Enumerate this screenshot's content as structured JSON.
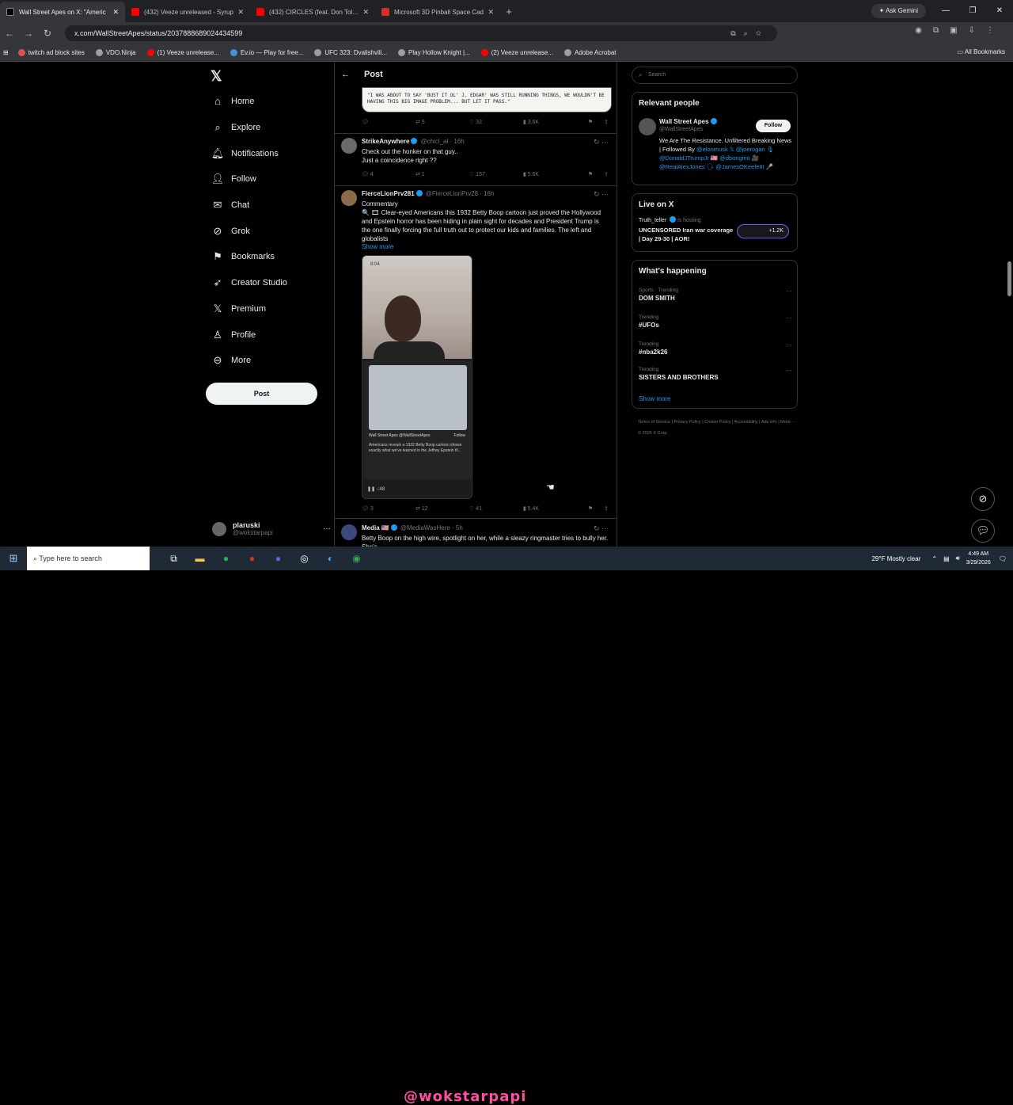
{
  "browser": {
    "tabs": [
      {
        "title": "Wall Street Apes on X: \"Americ",
        "color": "#e7e9ea",
        "active": true
      },
      {
        "title": "(432) Veeze unreleased - Syrup",
        "color": "#ff0000",
        "active": false
      },
      {
        "title": "(432) CIRCLES (feat. Don Toliver",
        "color": "#ff0000",
        "active": false
      },
      {
        "title": "Microsoft 3D Pinball Space Cad",
        "color": "#d93025",
        "active": false
      }
    ],
    "new_tab": "+",
    "ask_gemini": "Ask Gemini",
    "url": "x.com/WallStreetApes/status/2037888689024434599",
    "bookmarks": [
      {
        "label": "twitch ad block sites",
        "color": "#d9534f"
      },
      {
        "label": "VDO.Ninja",
        "color": "#9e9e9e"
      },
      {
        "label": "(1) Veeze unrelease...",
        "color": "#ff0000"
      },
      {
        "label": "Ev.io — Play for free...",
        "color": "#4a90d9"
      },
      {
        "label": "UFC 323: Dvalishvili...",
        "color": "#9e9e9e"
      },
      {
        "label": "Play Hollow Knight |...",
        "color": "#9e9e9e"
      },
      {
        "label": "(2) Veeze unrelease...",
        "color": "#ff0000"
      },
      {
        "label": "Adobe Acrobat",
        "color": "#9e9e9e"
      }
    ],
    "all_bookmarks": "All Bookmarks"
  },
  "nav": {
    "items": [
      {
        "label": "Home",
        "icon": "home-icon"
      },
      {
        "label": "Explore",
        "icon": "search-icon"
      },
      {
        "label": "Notifications",
        "icon": "bell-icon"
      },
      {
        "label": "Follow",
        "icon": "follow-icon"
      },
      {
        "label": "Chat",
        "icon": "mail-icon"
      },
      {
        "label": "Grok",
        "icon": "grok-icon"
      },
      {
        "label": "Bookmarks",
        "icon": "bookmark-icon"
      },
      {
        "label": "Creator Studio",
        "icon": "rocket-icon"
      },
      {
        "label": "Premium",
        "icon": "x-icon"
      },
      {
        "label": "Profile",
        "icon": "person-icon"
      },
      {
        "label": "More",
        "icon": "more-icon"
      }
    ],
    "post_button": "Post",
    "user": {
      "name": "plaruski",
      "handle": "@wokstarpapi"
    }
  },
  "timeline": {
    "header": "Post",
    "comic_text": "\"I WAS ABOUT TO SAY 'BUST IT OL' J. EDGAR' WAS STILL RUNNING THINGS, WE WOULDN'T BE HAVING THIS BIG IMAGE PROBLEM... BUT LET IT PASS.\"",
    "first_actions": {
      "replies": "",
      "reposts": "5",
      "likes": "32",
      "views": "3.6K"
    },
    "tweets": [
      {
        "author": "StrikeAnywhere",
        "handle": "@chicl_al · 16h",
        "text": "Check out the honker on that guy..\nJust a coincidence right ??",
        "replies": "4",
        "reposts": "1",
        "likes": "157",
        "views": "5.6K"
      },
      {
        "author": "FierceLionPrv281",
        "handle": "@FierceLionPrv28 · 16h",
        "label": "Commentary",
        "text": "🔍 🎞 Clear-eyed Americans this 1932 Betty Boop cartoon just proved the Hollywood and Epstein horror has been hiding in plain sight for decades and President Trump is the one finally forcing the full truth out to protect our kids and families. The left and globalists",
        "show_more": "Show more",
        "replies": "3",
        "reposts": "12",
        "likes": "41",
        "views": "5.4K"
      },
      {
        "author": "Media 🇺🇸",
        "handle": "@MediaWasHere · 5h",
        "text": "Betty Boop on the high wire, spotlight on her, while a sleazy ringmaster tries to bully her. She's"
      }
    ],
    "video": {
      "time": "8:04",
      "card_author": "Wall Street Apes",
      "card_handle": "@WallStreetApes",
      "card_follow": "Follow",
      "card_text": "Americans reveals a 1932 Betty Boop cartoon shows exactly what we've learned in the Jeffrey Epstein fil...",
      "counter": "-:48"
    }
  },
  "sidebar": {
    "search_placeholder": "Search",
    "relevant": {
      "title": "Relevant people",
      "name": "Wall Street Apes",
      "handle": "@WallStreetApes",
      "follow": "Follow",
      "bio": "We Are The Resistance. Unfiltered Breaking News | Followed By",
      "mentions": "@elonmusk 𝕏 @joerogan 🎙 @DonaldJTrumpJr 🇺🇸 @dbongino 🎥 @RealAlexJones 🗣 @JamesOKeefeIII 🎤"
    },
    "live": {
      "title": "Live on X",
      "host": "Truth_teller",
      "hosting": "is hosting",
      "stream_title": "UNCENSORED Iran war coverage | Day 29-30 | AOR!",
      "count": "+1.2K"
    },
    "happening": {
      "title": "What's happening",
      "trends": [
        {
          "category": "Sports · Trending",
          "name": "DOM SMITH"
        },
        {
          "category": "Trending",
          "name": "#UFOs"
        },
        {
          "category": "Trending",
          "name": "#nba2k26"
        },
        {
          "category": "Trending",
          "name": "SISTERS AND BROTHERS"
        }
      ],
      "show_more": "Show more"
    },
    "footer": "Terms of Service   |   Privacy Policy   |   Cookie Policy   |   Accessibility   |   Ads info   |   More ···   © 2026 X Corp."
  },
  "taskbar": {
    "search_placeholder": "Type here to search",
    "overlay_text": "@wokstarpapi",
    "weather": "29°F  Mostly clear",
    "time": "4:49 AM",
    "date": "3/29/2026"
  }
}
